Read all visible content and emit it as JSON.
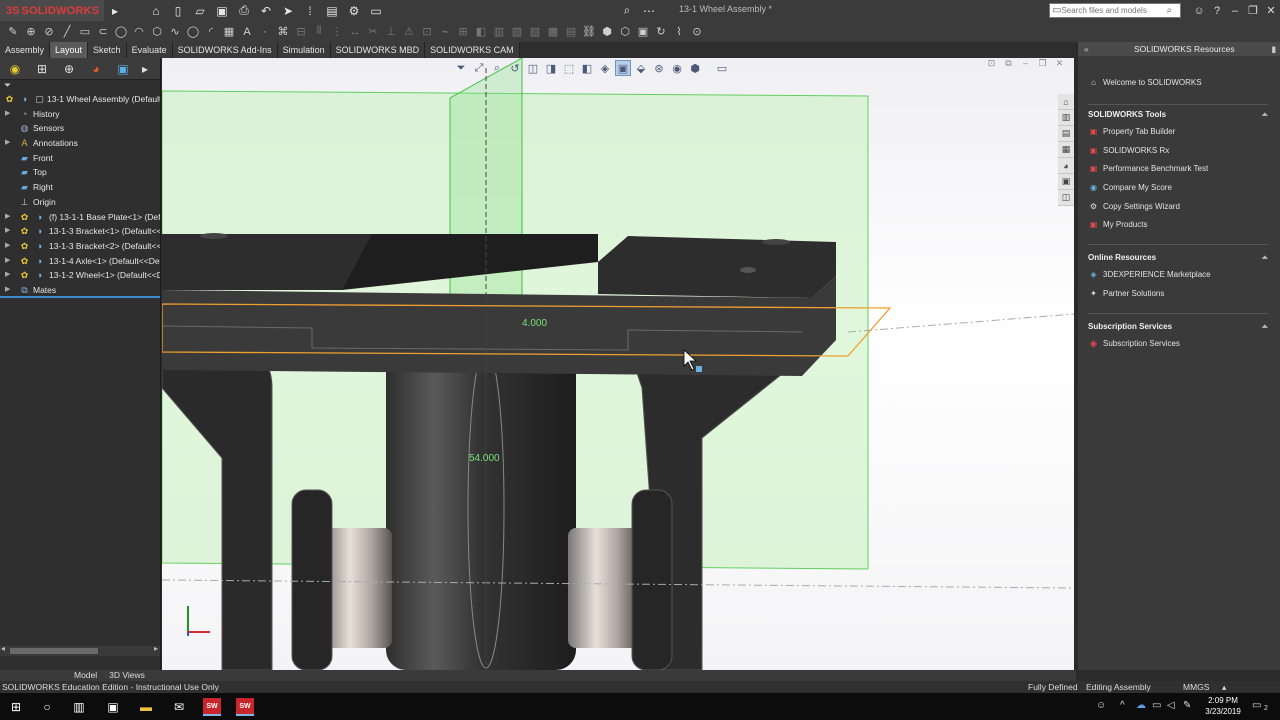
{
  "app": {
    "brand_ds": "3S",
    "brand_name": "SOLIDWORKS",
    "doc_title": "13-1 Wheel Assembly *",
    "search_placeholder": "Search files and models",
    "accent": "#e03a3a"
  },
  "command_tabs": [
    "Assembly",
    "Layout",
    "Sketch",
    "Evaluate",
    "SOLIDWORKS Add-Ins",
    "Simulation",
    "SOLIDWORKS MBD",
    "SOLIDWORKS CAM"
  ],
  "active_command_tab": "Layout",
  "feature_tree": {
    "root": "13-1 Wheel Assembly  (Default<",
    "items": [
      {
        "label": "History",
        "icon": "history-icon",
        "expand": true
      },
      {
        "label": "Sensors",
        "icon": "sensor-icon",
        "expand": false
      },
      {
        "label": "Annotations",
        "icon": "annotation-icon",
        "expand": true
      },
      {
        "label": "Front",
        "icon": "plane-icon",
        "expand": false
      },
      {
        "label": "Top",
        "icon": "plane-icon",
        "expand": false
      },
      {
        "label": "Right",
        "icon": "plane-icon",
        "expand": false
      },
      {
        "label": "Origin",
        "icon": "origin-icon",
        "expand": false
      },
      {
        "label": "(f) 13-1-1 Base Plate<1> (Defau",
        "icon": "part-icon",
        "expand": true
      },
      {
        "label": "13-1-3 Bracket<1> (Default<<D",
        "icon": "part-icon",
        "expand": true
      },
      {
        "label": "13-1-3 Bracket<2> (Default<<D",
        "icon": "part-icon",
        "expand": true
      },
      {
        "label": "13-1-4 Axle<1> (Default<<Defa",
        "icon": "part-icon",
        "expand": true
      },
      {
        "label": "13-1-2 Wheel<1> (Default<<De",
        "icon": "part-icon",
        "expand": true
      },
      {
        "label": "Mates",
        "icon": "mates-icon",
        "expand": true
      }
    ]
  },
  "viewport": {
    "dim_width": "4.000",
    "dim_height": "54.000"
  },
  "task_pane": {
    "title": "SOLIDWORKS Resources",
    "welcome": "Welcome to SOLIDWORKS",
    "sections": [
      {
        "title": "SOLIDWORKS Tools",
        "items": [
          "Property Tab Builder",
          "SOLIDWORKS Rx",
          "Performance Benchmark Test",
          "Compare My Score",
          "Copy Settings Wizard",
          "My Products"
        ]
      },
      {
        "title": "Online Resources",
        "items": [
          "3DEXPERIENCE Marketplace",
          "Partner Solutions"
        ]
      },
      {
        "title": "Subscription Services",
        "items": [
          "Subscription Services"
        ]
      }
    ]
  },
  "bottom_tabs": [
    "Model",
    "3D Views"
  ],
  "status": {
    "left": "SOLIDWORKS Education Edition - Instructional Use Only",
    "defined": "Fully Defined",
    "mode": "Editing Assembly",
    "units": "MMGS"
  },
  "clock": {
    "time": "2:09 PM",
    "date": "3/23/2019"
  },
  "notification_count": "2"
}
